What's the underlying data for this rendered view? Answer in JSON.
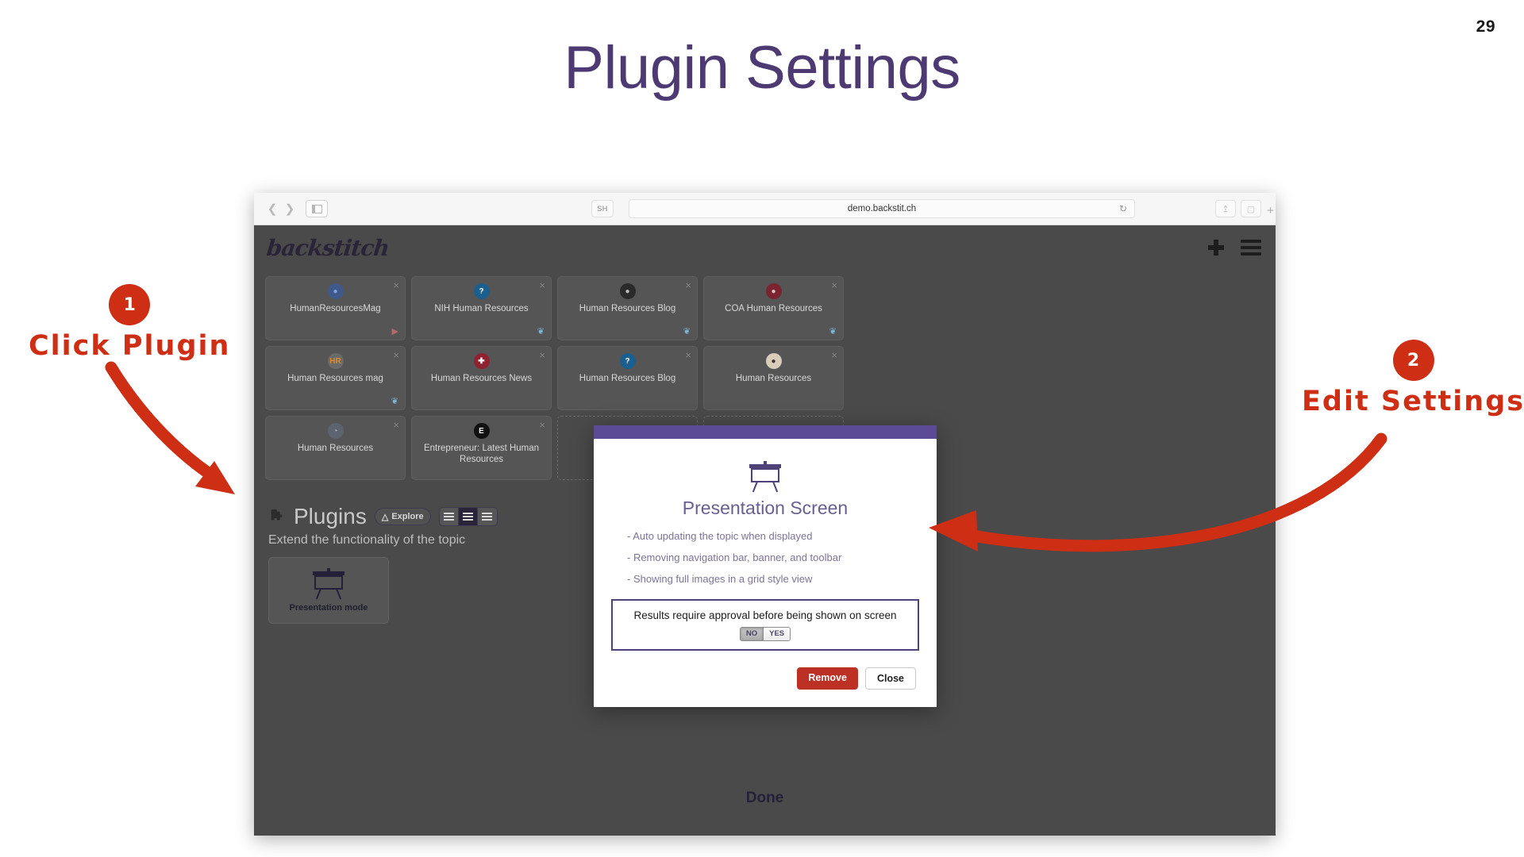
{
  "slide": {
    "title": "Plugin Settings",
    "page_number": "29",
    "title_color": "#4e3a72"
  },
  "browser": {
    "url": "demo.backstit.ch",
    "shortcut_label": "SH",
    "back_icon": "chevron-left-icon",
    "forward_icon": "chevron-right-icon",
    "sidebar_icon": "sidebar-toggle-icon",
    "reload_icon": "reload-icon",
    "share_icon": "share-icon",
    "tabs_icon": "tabs-icon",
    "new_tab_icon": "plus-icon"
  },
  "app": {
    "logo": "backstitch",
    "add_icon": "plus-icon",
    "menu_icon": "hamburger-menu-icon",
    "done_label": "Done",
    "cards": [
      {
        "title": "HumanResourcesMag",
        "source": "youtube",
        "avatar_bg": "#3f5a8a",
        "avatar_fg": "#7aa3e0",
        "glyph": "●"
      },
      {
        "title": "NIH Human Resources",
        "source": "twitter",
        "avatar_bg": "#1b5f8f",
        "avatar_fg": "#ffffff",
        "glyph": "?"
      },
      {
        "title": "Human Resources Blog",
        "source": "twitter",
        "avatar_bg": "#2a2a2a",
        "avatar_fg": "#bdbdbd",
        "glyph": "●"
      },
      {
        "title": "COA Human Resources",
        "source": "twitter",
        "avatar_bg": "#7a2430",
        "avatar_fg": "#e0c0c0",
        "glyph": "●"
      },
      {
        "title": "Human Resources mag",
        "source": "twitter",
        "avatar_bg": "#6a6a6a",
        "avatar_fg": "#e08a2a",
        "glyph": "HR"
      },
      {
        "title": "Human Resources News",
        "source": "",
        "avatar_bg": "#8e2230",
        "avatar_fg": "#ffffff",
        "glyph": "✚"
      },
      {
        "title": "Human Resources Blog",
        "source": "",
        "avatar_bg": "#1b5f8f",
        "avatar_fg": "#ffffff",
        "glyph": "?"
      },
      {
        "title": "Human Resources",
        "source": "",
        "avatar_bg": "#d8cdbb",
        "avatar_fg": "#3a3228",
        "glyph": "●"
      },
      {
        "title": "Human Resources",
        "source": "",
        "avatar_bg": "#5c6470",
        "avatar_fg": "#aab4c4",
        "glyph": "◔"
      },
      {
        "title": "Entrepreneur: Latest Human Resources",
        "source": "",
        "avatar_bg": "#111111",
        "avatar_fg": "#ffffff",
        "glyph": "E"
      }
    ],
    "plugins": {
      "heading": "Plugins",
      "subheading": "Extend the functionality of the topic",
      "explore_label": "Explore",
      "explore_icon": "flask-icon",
      "puzzle_icon": "puzzle-piece-icon",
      "view_modes": [
        "list-view",
        "card-view",
        "compact-view"
      ],
      "active_view_index": 1,
      "items": [
        {
          "label": "Presentation mode",
          "icon": "presentation-screen-icon"
        }
      ]
    }
  },
  "modal": {
    "accent_color": "#5b4a96",
    "icon": "presentation-screen-icon",
    "title": "Presentation Screen",
    "bullets": [
      "- Auto updating the topic when displayed",
      "- Removing navigation bar, banner, and toolbar",
      "- Showing full images in a grid style view"
    ],
    "setting": {
      "label": "Results require approval before being shown on screen",
      "options": [
        "NO",
        "YES"
      ],
      "selected": "NO"
    },
    "buttons": {
      "remove": "Remove",
      "close": "Close"
    }
  },
  "annotations": {
    "color": "#ce2e14",
    "items": [
      {
        "number": "1",
        "text": "Click  Plugin"
      },
      {
        "number": "2",
        "text": "Edit  Settings"
      }
    ]
  }
}
